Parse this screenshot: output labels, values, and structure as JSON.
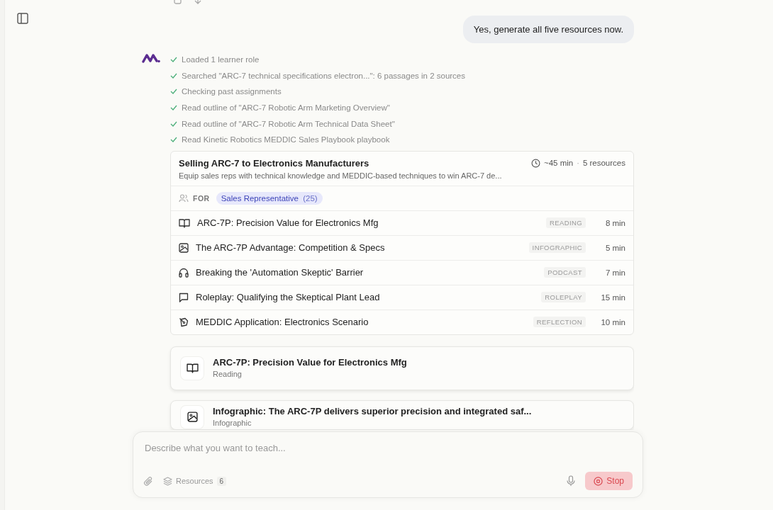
{
  "user_message": "Yes, generate all five resources now.",
  "steps": [
    {
      "text": "Loaded 1 learner role",
      "done": true
    },
    {
      "text": "Searched \"ARC-7 technical specifications electron...\": 6 passages in 2 sources",
      "done": true
    },
    {
      "text": "Checking past assignments",
      "done": true
    },
    {
      "text": "Read outline of \"ARC-7 Robotic Arm Marketing Overview\"",
      "done": true
    },
    {
      "text": "Read outline of \"ARC-7 Robotic Arm Technical Data Sheet\"",
      "done": true
    },
    {
      "text": "Read Kinetic Robotics MEDDIC Sales Playbook playbook",
      "done": true
    }
  ],
  "plan": {
    "title": "Selling ARC-7 to Electronics Manufacturers",
    "description": "Equip sales reps with technical knowledge and MEDDIC-based techniques to win ARC-7 de...",
    "duration": "~45 min",
    "separator": "·",
    "resource_count": "5 resources",
    "for_label": "FOR",
    "audience": "Sales Representative",
    "audience_count": "(25)",
    "resources": [
      {
        "kind": "reading",
        "title": "ARC-7P: Precision Value for Electronics Mfg",
        "type": "READING",
        "time": "8 min"
      },
      {
        "kind": "infographic",
        "title": "The ARC-7P Advantage: Competition & Specs",
        "type": "INFOGRAPHIC",
        "time": "5 min"
      },
      {
        "kind": "podcast",
        "title": "Breaking the 'Automation Skeptic' Barrier",
        "type": "PODCAST",
        "time": "7 min"
      },
      {
        "kind": "roleplay",
        "title": "Roleplay: Qualifying the Skeptical Plant Lead",
        "type": "ROLEPLAY",
        "time": "15 min"
      },
      {
        "kind": "reflection",
        "title": "MEDDIC Application: Electronics Scenario",
        "type": "REFLECTION",
        "time": "10 min"
      }
    ]
  },
  "generated": [
    {
      "kind": "reading",
      "title": "ARC-7P: Precision Value for Electronics Mfg",
      "subtitle": "Reading"
    },
    {
      "kind": "infographic",
      "title": "Infographic: The ARC-7P delivers superior precision and integrated saf...",
      "subtitle": "Infographic"
    }
  ],
  "composer": {
    "placeholder": "Describe what you want to teach...",
    "resources_label": "Resources",
    "resources_count": "6",
    "stop_label": "Stop"
  }
}
